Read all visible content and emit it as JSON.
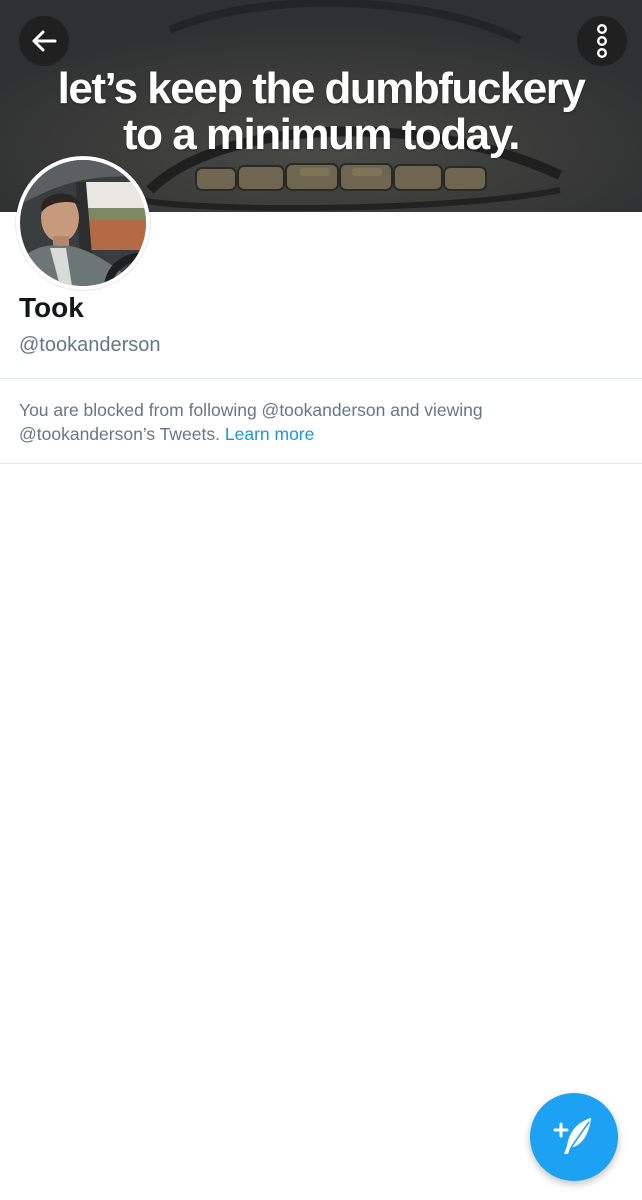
{
  "banner": {
    "caption_line1": "let’s keep the dumbfuckery",
    "caption_line2": "to a minimum today."
  },
  "header": {
    "back_icon": "arrow-left-icon",
    "more_icon": "vertical-dots-icon"
  },
  "profile": {
    "display_name": "Took",
    "handle": "@tookanderson"
  },
  "notice": {
    "text": "You are blocked from following @tookanderson and viewing @tookanderson’s Tweets.",
    "link_label": "Learn more"
  },
  "fab": {
    "icon": "compose-tweet-icon"
  },
  "colors": {
    "accent": "#1da1f2",
    "link": "#1b95e0",
    "secondary_text": "#657786",
    "primary_text": "#14171a",
    "divider": "#e1e8ed"
  }
}
